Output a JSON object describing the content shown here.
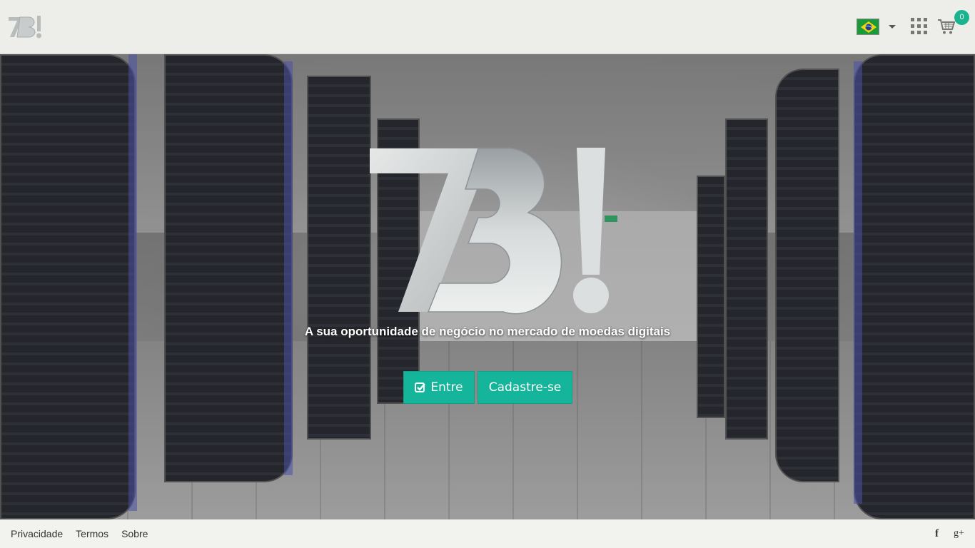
{
  "header": {
    "logo_text": "7B!",
    "language": "pt-BR",
    "cart_count": "0",
    "icons": [
      "brazil-flag-icon",
      "apps-grid-icon",
      "cart-icon"
    ]
  },
  "hero": {
    "logo_text": "7B!",
    "tagline": "A sua oportunidade de negócio no mercado de moedas digitais",
    "login_label": "Entre",
    "signup_label": "Cadastre-se",
    "accent_color": "#14b59a"
  },
  "footer": {
    "links": [
      "Privacidade",
      "Termos",
      "Sobre"
    ],
    "social": [
      "facebook-icon",
      "google-plus-icon"
    ],
    "facebook_glyph": "f",
    "gplus_glyph": "g+"
  }
}
